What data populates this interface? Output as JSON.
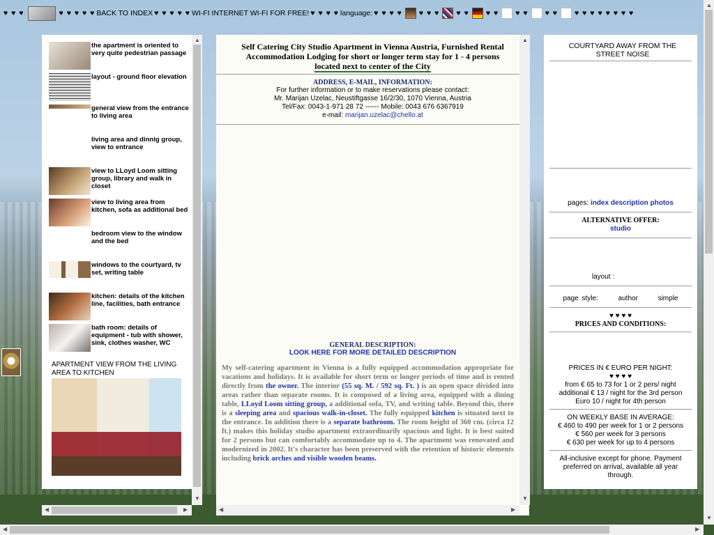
{
  "topbar": {
    "hearts_a": "♥ ♥ ♥",
    "hearts_b": "♥ ♥ ♥ ♥ ♥",
    "back_label": "BACK TO INDEX",
    "hearts_c": "♥ ♥ ♥ ♥ ♥",
    "wifi_label": "WI-FI INTERNET WI-FI FOR FREE!",
    "hearts_d": "♥ ♥ ♥ ♥",
    "language_label": "language:",
    "hearts_e": "♥ ♥ ♥ ♥",
    "hearts_f": "♥ ♥ ♥",
    "hearts_g": "♥ ♥",
    "hearts_h": "♥ ♥",
    "hearts_i": "♥ ♥",
    "hearts_j": "♥ ♥",
    "hearts_k": "♥ ♥ ♥ ♥ ♥ ♥ ♥ ♥",
    "flag_icons": [
      "person-photo-icon",
      "uk-flag-icon",
      "german-flag-icon"
    ]
  },
  "left": {
    "items": [
      "the apartment is oriented to very quite pedestrian passage",
      "layout - ground floor elevation",
      "general view from the entrance to living area",
      "living area and dinnig group, view to entrance",
      "view to LLoyd Loom sitting group, library and walk in closet",
      "view to living area from kitchen, sofa as additional bed",
      "bedroom view to the window and the bed",
      "windows to the courtyard, tv set, writing table",
      "kitchen: details of the kitchen line, facilities, bath entrance",
      "bath room: details of equipment - tub with shower, sink, clothes washer, WC"
    ],
    "caption": "APARTMENT VIEW FROM THE LIVING AREA TO KITCHEN"
  },
  "center": {
    "title_line1": "Self Catering City Studio Apartment in Vienna Austria, Furnished Rental",
    "title_line2": "Accommodation Lodging for short or longer term stay for 1 - 4 persons",
    "title_line3": "located next to center of the City",
    "address_heading": "ADDRESS, E-MAIL, INFORMATION:",
    "contact_intro": "For further information or to make reservations please contact:",
    "contact_address": "Mr. Marijan Uzelac, Neustiftgasse 16/2/30, 1070 Vienna, Austria",
    "contact_phone": "Tel/Fax: 0043-1-971 28 72 ------ Mobile: 0043 676 6367919",
    "email_label": "e-mail:",
    "email": "marijan.uzelac@chello.at",
    "general_heading": "GENERAL DESCRIPTION:",
    "general_link": "LOOK HERE FOR MORE DETAILED DESCRIPTION",
    "desc": {
      "t1": "My self-catering apartment in Vienna is a fully equipped accommodation appropriate for vacations and holidays. It is available for short term or longer periods of time and is rented directly from ",
      "l1": "the owner.",
      "t2": " The interior ",
      "l2": "(55 sq. M. / 592 sq. Ft. )",
      "t3": " is an open space divided into areas rather than separate rooms. It is composed of a living area, equipped with a dining table, ",
      "l3": "LLoyd Loom sitting group,",
      "t4": " a additional sofa, TV, and writing table. Beyond this, there is a ",
      "l4": "sleeping area",
      "t5": " and ",
      "l5": "spacious walk-in-closet.",
      "t6": " The fully equipped ",
      "l6": "kitchen",
      "t7": " is situated next to the entrance. In addition there is a ",
      "l7": "separate bathroom.",
      "t8": " The room height of 360 cm. (circa 12 ft.) makes this holiday studio apartment extraordinarily spacious and light. It is best suited for 2 persons but can comfortably accommodate up to 4. The apartment was renovated and modernized in 2002. It's character has been preserved with the retention of historic elements including ",
      "l8": "brick arches and visible wooden beams."
    }
  },
  "right": {
    "top_text": "COURTYARD AWAY FROM THE STREET NOISE",
    "pages_label": "pages:",
    "pages_links": [
      "index",
      "description",
      "photos"
    ],
    "alt_heading": "ALTERNATIVE OFFER:",
    "alt_link": "studio",
    "layout_label": "layout :",
    "page_style_label": "page style:",
    "style_author": "author",
    "style_simple": "simple",
    "hearts": "♥ ♥ ♥ ♥",
    "prices_heading": "PRICES AND CONDITIONS:",
    "night_heading": "PRICES IN € EURO PER NIGHT:",
    "night_hearts": "♥ ♥ ♥ ♥",
    "night_lines": [
      "from € 65 to 73 for 1 or 2 pers/ night",
      "additional € 13 / night for the 3rd person",
      "Euro 10 / night for 4th person"
    ],
    "weekly_heading": "ON WEEKLY BASE IN AVERAGE:",
    "weekly_lines": [
      "€ 460 to 490 per week for 1 or 2 persons",
      "€ 560 per week for 3 persons",
      "€ 630 per week for up to 4 persons"
    ],
    "footer_text": "All-inclusive except for phone. Payment preferred on arrival, available all year through."
  }
}
